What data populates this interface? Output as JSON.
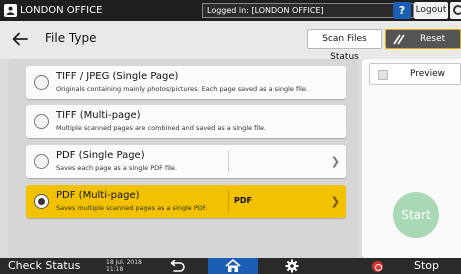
{
  "topbar": {
    "user_label": "LONDON OFFICE",
    "login_status": "Logged in: [LONDON OFFICE]",
    "help_label": "?",
    "logout_label": "Logout"
  },
  "header": {
    "title": "File Type",
    "scan_status_label": "Scan Files Status",
    "reset_label": "Reset"
  },
  "options": [
    {
      "title": "TIFF / JPEG (Single Page)",
      "desc": "Originals containing mainly photos/pictures. Each page saved as a single file.",
      "selected": false
    },
    {
      "title": "TIFF (Multi-page)",
      "desc": "Multiple scanned pages are combined and saved as a single file.",
      "selected": false
    },
    {
      "title": "PDF (Single Page)",
      "desc": "Saves each page as a single PDF file.",
      "subvalue": "",
      "selected": false
    },
    {
      "title": "PDF (Multi-page)",
      "desc": "Saves multiple scanned pages as a single PDF.",
      "subvalue": "PDF",
      "selected": true
    }
  ],
  "side": {
    "preview_label": "Preview",
    "start_label": "Start"
  },
  "bottombar": {
    "check_status_label": "Check Status",
    "date": "18 Jul. 2018",
    "time": "11:18",
    "stop_label": "Stop"
  },
  "colors": {
    "accent_yellow": "#f2c200",
    "home_blue": "#1b5fb4",
    "start_green": "#a9d9b4"
  }
}
